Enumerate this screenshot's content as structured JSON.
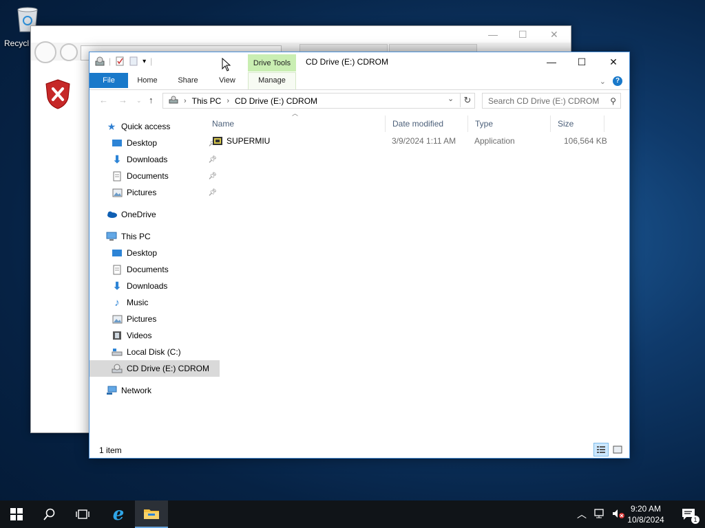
{
  "desktop": {
    "recycle_label": "Recycl"
  },
  "explorer": {
    "title": "CD Drive (E:) CDROM",
    "contextual_tab": "Drive Tools",
    "ribbon_tabs": {
      "file": "File",
      "home": "Home",
      "share": "Share",
      "view": "View",
      "manage": "Manage"
    },
    "address": {
      "this_pc": "This PC",
      "location": "CD Drive (E:) CDROM"
    },
    "search_placeholder": "Search CD Drive (E:) CDROM",
    "nav": {
      "quick_access": "Quick access",
      "qa_desktop": "Desktop",
      "qa_downloads": "Downloads",
      "qa_documents": "Documents",
      "qa_pictures": "Pictures",
      "onedrive": "OneDrive",
      "this_pc": "This PC",
      "pc_desktop": "Desktop",
      "pc_documents": "Documents",
      "pc_downloads": "Downloads",
      "pc_music": "Music",
      "pc_pictures": "Pictures",
      "pc_videos": "Videos",
      "local_disk": "Local Disk (C:)",
      "cd_drive": "CD Drive (E:) CDROM",
      "network": "Network"
    },
    "columns": {
      "name": "Name",
      "date": "Date modified",
      "type": "Type",
      "size": "Size"
    },
    "files": [
      {
        "name": "SUPERMIU",
        "date": "3/9/2024 1:11 AM",
        "type": "Application",
        "size": "106,564 KB"
      }
    ],
    "status": "1 item"
  },
  "taskbar": {
    "time": "9:20 AM",
    "date": "10/8/2024",
    "notification_count": "1"
  },
  "colors": {
    "accent": "#1979ca",
    "drive_tools": "#c9eeb2",
    "taskbar": "#101418"
  }
}
